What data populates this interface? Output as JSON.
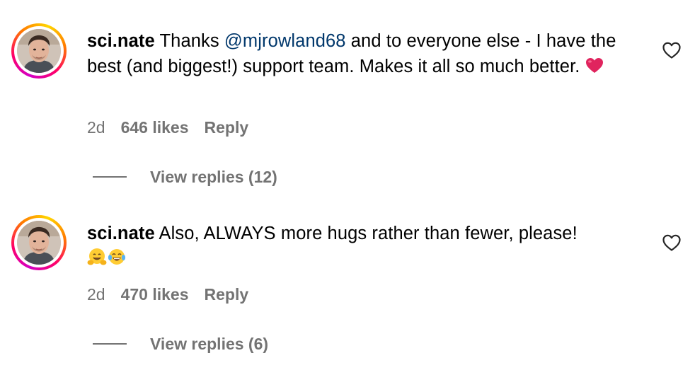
{
  "comments": [
    {
      "username": "sci.nate",
      "text_before": "Thanks ",
      "mention": "@mjrowland68",
      "text_after": " and to everyone else - I have the best (and biggest!) support team. Makes it all so much better. ",
      "emojis": [
        "red-heart"
      ],
      "time": "2d",
      "likes": "646 likes",
      "reply_label": "Reply",
      "view_replies": "View replies (12)"
    },
    {
      "username": "sci.nate",
      "text_before": "Also, ALWAYS more hugs rather than fewer, please!",
      "mention": "",
      "text_after": "",
      "emojis": [
        "hugging-face",
        "tears-of-joy"
      ],
      "time": "2d",
      "likes": "470 likes",
      "reply_label": "Reply",
      "view_replies": "View replies (6)"
    }
  ],
  "icons": {
    "like": "heart-outline-icon",
    "avatar_ring_colors": [
      "#d300c5",
      "#ff0069",
      "#ff7a00",
      "#ffd600"
    ]
  },
  "colors": {
    "mention": "#00376b",
    "secondary_text": "#737373",
    "heart_emoji": "#e0245e"
  }
}
